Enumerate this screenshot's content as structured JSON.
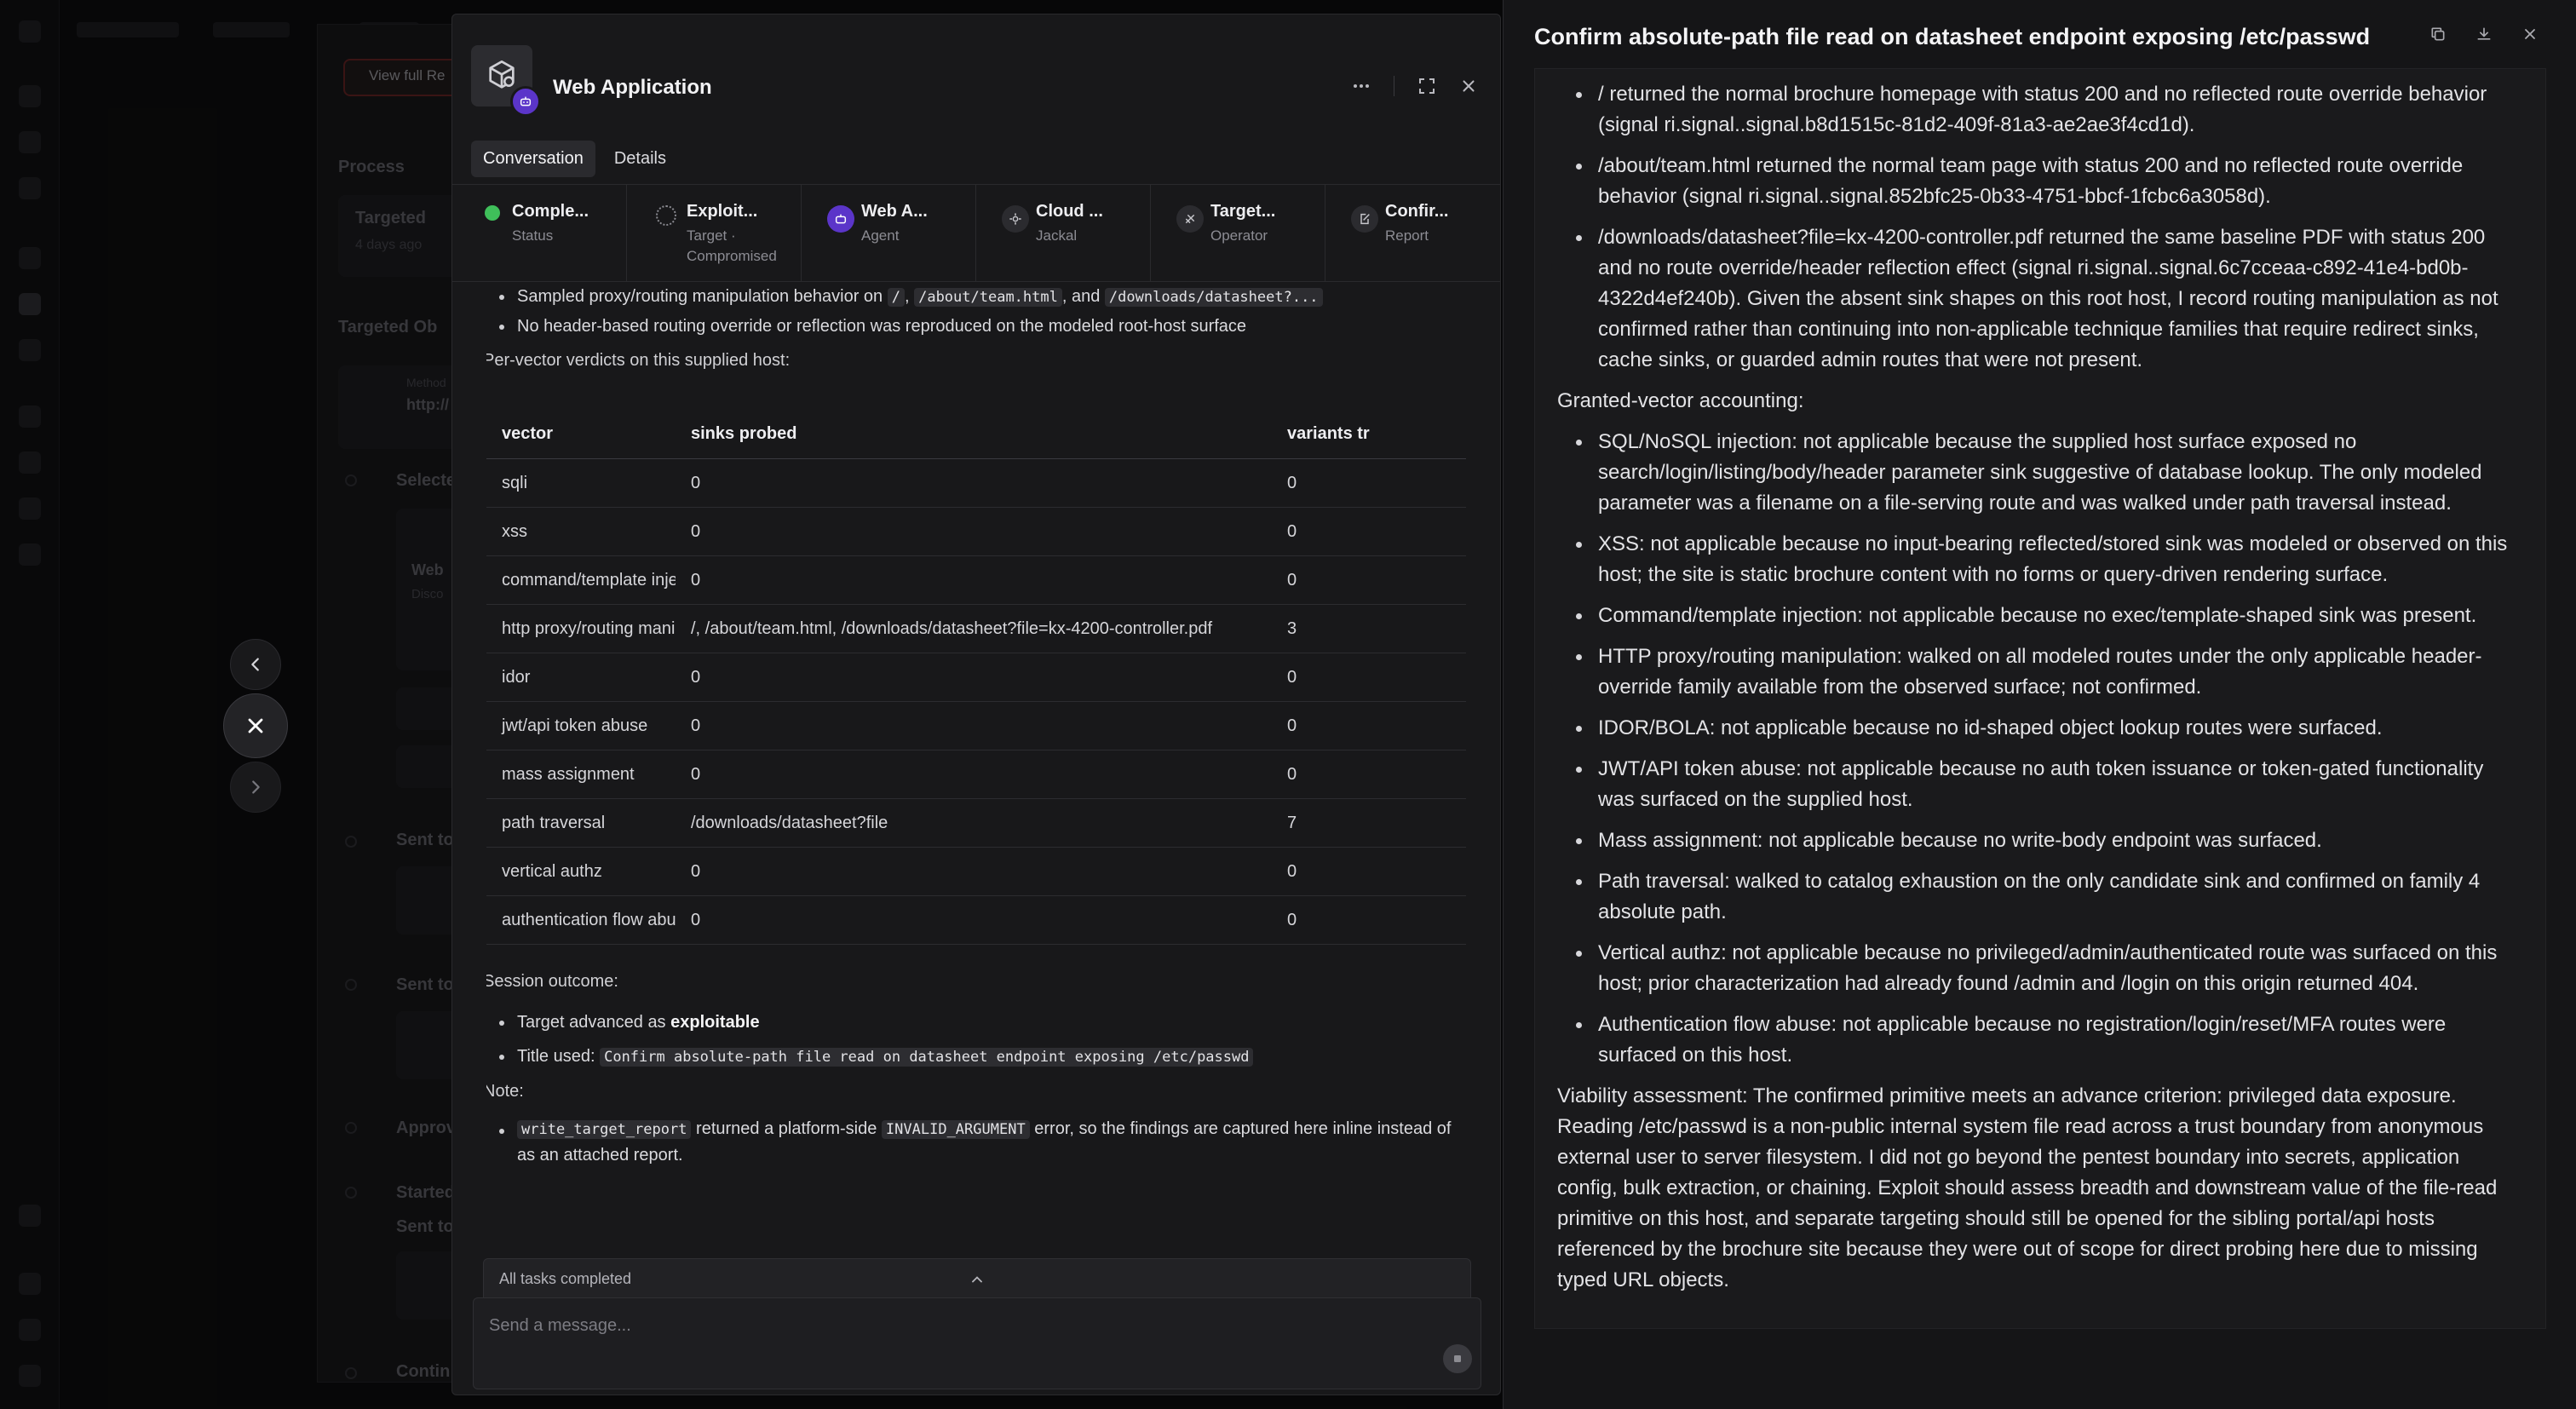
{
  "left_panel": {
    "agent_title": "Web Application",
    "tabs": [
      "Conversation",
      "Details"
    ],
    "status_chips": [
      {
        "title": "Comple...",
        "sub": "Status"
      },
      {
        "title": "Exploit...",
        "sub": "Target · Compromised"
      },
      {
        "title": "Web A...",
        "sub": "Agent"
      },
      {
        "title": "Cloud ...",
        "sub": "Jackal"
      },
      {
        "title": "Target...",
        "sub": "Operator"
      },
      {
        "title": "Confir...",
        "sub": "Report"
      }
    ],
    "conversation": {
      "bullet1_prefix": "Sampled proxy/routing manipulation behavior on",
      "bullet1_code1": "/",
      "bullet1_code2": "/about/team.html",
      "bullet1_and": ", and",
      "bullet1_code3": "/downloads/datasheet?...",
      "bullet2": "No header-based routing override or reflection was reproduced on the modeled root-host surface",
      "verdicts_intro": "Per-vector verdicts on this supplied host:",
      "table": {
        "headers": [
          "vector",
          "sinks probed",
          "variants tr"
        ],
        "rows": [
          [
            "sqli",
            "0",
            "0"
          ],
          [
            "xss",
            "0",
            "0"
          ],
          [
            "command/template injection",
            "0",
            "0"
          ],
          [
            "http proxy/routing manipulation",
            "/, /about/team.html, /downloads/datasheet?file=kx-4200-controller.pdf",
            "3"
          ],
          [
            "idor",
            "0",
            "0"
          ],
          [
            "jwt/api token abuse",
            "0",
            "0"
          ],
          [
            "mass assignment",
            "0",
            "0"
          ],
          [
            "path traversal",
            "/downloads/datasheet?file",
            "7"
          ],
          [
            "vertical authz",
            "0",
            "0"
          ],
          [
            "authentication flow abuse",
            "0",
            "0"
          ]
        ]
      },
      "session_outcome_label": "Session outcome:",
      "outcome_prefix": "Target advanced as",
      "outcome_bold": "exploitable",
      "title_used_prefix": "Title used:",
      "title_used_code": "Confirm absolute-path file read on datasheet endpoint exposing /etc/passwd",
      "note_label": "Note:",
      "note_code1": "write_target_report",
      "note_mid": "returned a platform-side",
      "note_code2": "INVALID_ARGUMENT",
      "note_end": "error, so the findings are captured here inline instead of as an attached report."
    },
    "tasks_status": "All tasks completed",
    "message_placeholder": "Send a message..."
  },
  "right_panel": {
    "title": "Confirm absolute-path file read on datasheet endpoint exposing /etc/passwd",
    "routes_bullets": [
      "/ returned the normal brochure homepage with status 200 and no reflected route override behavior (signal ri.signal..signal.b8d1515c-81d2-409f-81a3-ae2ae3f4cd1d).",
      "/about/team.html returned the normal team page with status 200 and no reflected route override behavior (signal ri.signal..signal.852bfc25-0b33-4751-bbcf-1fcbc6a3058d).",
      "/downloads/datasheet?file=kx-4200-controller.pdf returned the same baseline PDF with status 200 and no route override/header reflection effect (signal ri.signal..signal.6c7cceaa-c892-41e4-bd0b-4322d4ef240b). Given the absent sink shapes on this root host, I record routing manipulation as not confirmed rather than continuing into non-applicable technique families that require redirect sinks, cache sinks, or guarded admin routes that were not present."
    ],
    "accounting_heading": "Granted-vector accounting:",
    "accounting_bullets": [
      "SQL/NoSQL injection: not applicable because the supplied host surface exposed no search/login/listing/body/header parameter sink suggestive of database lookup. The only modeled parameter was a filename on a file-serving route and was walked under path traversal instead.",
      "XSS: not applicable because no input-bearing reflected/stored sink was modeled or observed on this host; the site is static brochure content with no forms or query-driven rendering surface.",
      "Command/template injection: not applicable because no exec/template-shaped sink was present.",
      "HTTP proxy/routing manipulation: walked on all modeled routes under the only applicable header-override family available from the observed surface; not confirmed.",
      "IDOR/BOLA: not applicable because no id-shaped object lookup routes were surfaced.",
      "JWT/API token abuse: not applicable because no auth token issuance or token-gated functionality was surfaced on the supplied host.",
      "Mass assignment: not applicable because no write-body endpoint was surfaced.",
      "Path traversal: walked to catalog exhaustion on the only candidate sink and confirmed on family 4 absolute path.",
      "Vertical authz: not applicable because no privileged/admin/authenticated route was surfaced on this host; prior characterization had already found /admin and /login on this origin returned 404.",
      "Authentication flow abuse: not applicable because no registration/login/reset/MFA routes were surfaced on this host."
    ],
    "viability": "Viability assessment: The confirmed primitive meets an advance criterion: privileged data exposure. Reading /etc/passwd is a non-public internal system file read across a trust boundary from anonymous external user to server filesystem. I did not go beyond the pentest boundary into secrets, application config, bulk extraction, or chaining. Exploit should assess breadth and downstream value of the file-read primitive on this host, and separate targeting should still be opened for the sibling portal/api hosts referenced by the brochure site because they were out of scope for direct probing here due to missing typed URL objects."
  },
  "background": {
    "view_full_label": "View full Re",
    "process_label": "Process",
    "targeted_label": "Targeted",
    "targeted_sub": "4 days ago",
    "targeted_objects_label": "Targeted Ob",
    "method_label": "Method",
    "method_url": "http://",
    "select_label": "Selecte",
    "web_label": "Web",
    "web_sub": "Disco",
    "sent1": "Sent to",
    "sent2": "Sent to",
    "approve": "Approv",
    "started": "Started",
    "sent3": "Sent to",
    "continue": "Contin"
  }
}
